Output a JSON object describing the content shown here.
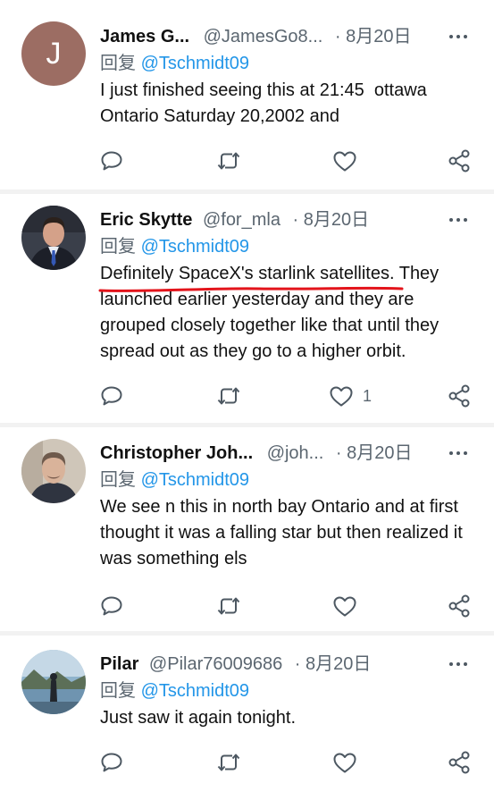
{
  "tweets": [
    {
      "name": "James G...",
      "handle": "@JamesGo8...",
      "sep": "·",
      "date": "8月20日",
      "reply_prefix": "回复",
      "reply_mention": "@Tschmidt09",
      "text": "I just finished seeing this at 21:45  ottawa Ontario Saturday 20,2002 and",
      "avatar_letter": "J",
      "like_count": ""
    },
    {
      "name": "Eric Skytte",
      "handle": "@for_mla",
      "sep": "·",
      "date": "8月20日",
      "reply_prefix": "回复",
      "reply_mention": "@Tschmidt09",
      "text_highlight": "Definitely SpaceX's starlink satellites",
      "text_rest": ". They launched earlier yesterday and they are grouped closely together like that until they spread out as they go to a higher orbit.",
      "like_count": "1"
    },
    {
      "name": "Christopher Joh...",
      "handle": "@joh...",
      "sep": "·",
      "date": "8月20日",
      "reply_prefix": "回复",
      "reply_mention": "@Tschmidt09",
      "text": "We see n this in north bay Ontario and at first thought it was a falling star but then realized it was something els",
      "like_count": ""
    },
    {
      "name": "Pilar",
      "handle": "@Pilar76009686",
      "sep": "·",
      "date": "8月20日",
      "reply_prefix": "回复",
      "reply_mention": "@Tschmidt09",
      "text": "Just saw it again tonight.",
      "like_count": ""
    }
  ],
  "icons": {
    "reply": "reply-icon",
    "retweet": "retweet-icon",
    "like": "heart-icon",
    "share": "share-icon",
    "more": "more-icon"
  },
  "colors": {
    "mention": "#2396e8",
    "annotation": "#e3141b",
    "secondary_text": "#5b6670"
  }
}
